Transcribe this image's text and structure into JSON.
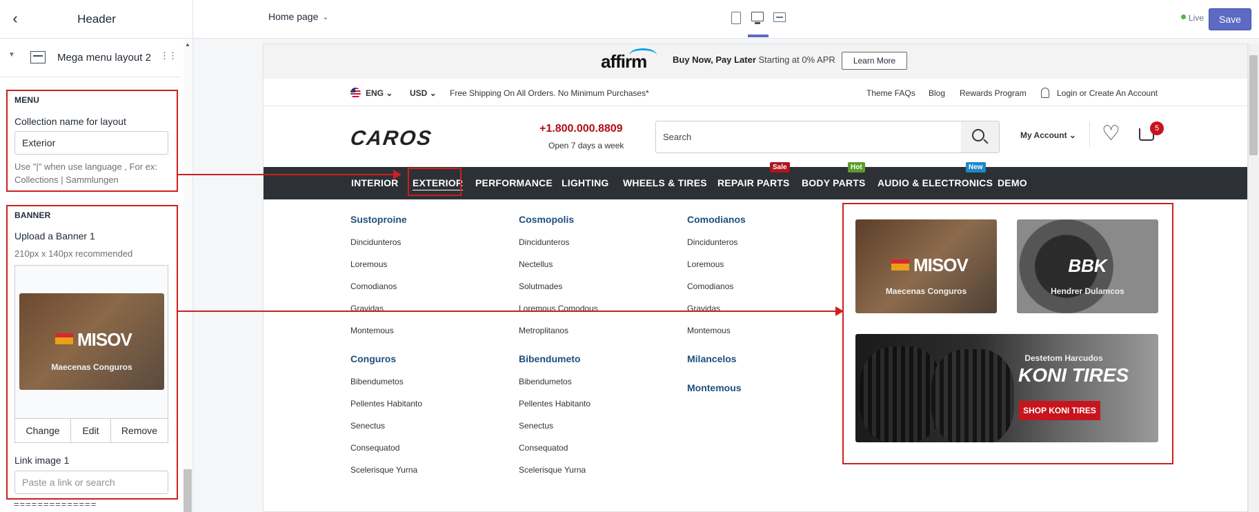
{
  "sidebar": {
    "title": "Header",
    "layout_name": "Mega menu layout 2",
    "menu": {
      "section_title": "MENU",
      "collection_label": "Collection name for layout",
      "collection_value": "Exterior",
      "help": "Use \"|\" when use language , For ex: Collections | Sammlungen"
    },
    "banner": {
      "section_title": "BANNER",
      "upload_label": "Upload a Banner 1",
      "upload_help": "210px x 140px recommended",
      "thumb_caption": "Maecenas Conguros",
      "thumb_brand": "MISOV",
      "change_label": "Change",
      "edit_label": "Edit",
      "remove_label": "Remove",
      "link_label": "Link image 1",
      "link_placeholder": "Paste a link or search"
    },
    "divider_text": "=============="
  },
  "topbar": {
    "page_select": "Home page",
    "live_label": "Live",
    "save_label": "Save",
    "accent": "#5c6ac4"
  },
  "store": {
    "promo": {
      "logo": "affirm",
      "headline": "Buy Now, Pay Later",
      "sub": " Starting at 0% APR",
      "button": "Learn More"
    },
    "utility": {
      "lang": "ENG",
      "currency": "USD",
      "shipping": "Free Shipping On All Orders. No Minimum Purchases*",
      "links": [
        "Theme FAQs",
        "Blog",
        "Rewards Program"
      ],
      "account": "Login or Create An Account"
    },
    "logo": "CAROS",
    "phone": "+1.800.000.8809",
    "phone_sub": "Open 7 days a week",
    "search_placeholder": "Search",
    "my_account": "My Account",
    "cart_count": "5",
    "nav": [
      {
        "label": "INTERIOR"
      },
      {
        "label": "EXTERIOR"
      },
      {
        "label": "PERFORMANCE"
      },
      {
        "label": "LIGHTING"
      },
      {
        "label": "WHEELS & TIRES"
      },
      {
        "label": "REPAIR PARTS",
        "badge": "Sale"
      },
      {
        "label": "BODY PARTS",
        "badge": "Hot"
      },
      {
        "label": "AUDIO & ELECTRONICS",
        "badge": "New"
      },
      {
        "label": "DEMO"
      }
    ],
    "badge_colors": {
      "Sale": "#b0141c",
      "Hot": "#5d9b2b",
      "New": "#1e88c8"
    },
    "mega": {
      "col1": {
        "h1": "Sustoproine",
        "l1": [
          "Dincidunteros",
          "Loremous",
          "Comodianos",
          "Gravidas",
          "Montemous"
        ],
        "h2": "Conguros",
        "l2": [
          "Bibendumetos",
          "Pellentes Habitanto",
          "Senectus",
          "Consequatod",
          "Scelerisque Yurna"
        ]
      },
      "col2": {
        "h1": "Cosmopolis",
        "l1": [
          "Dincidunteros",
          "Nectellus",
          "Solutmades",
          "Loremous Comodous",
          "Metroplitanos"
        ],
        "h2": "Bibendumeto",
        "l2": [
          "Bibendumetos",
          "Pellentes Habitanto",
          "Senectus",
          "Consequatod",
          "Scelerisque Yurna"
        ]
      },
      "col3": {
        "h1": "Comodianos",
        "l1": [
          "Dincidunteros",
          "Loremous",
          "Comodianos",
          "Gravidas",
          "Montemous"
        ],
        "h2": "Milancelos",
        "h3": "Montemous"
      }
    },
    "banners": {
      "b1_brand": "MISOV",
      "b1_caption": "Maecenas Conguros",
      "b2_brand": "BBK",
      "b2_caption": "Hendrer Dulamcos",
      "b3_top": "Destetom Harcudos",
      "b3_brand": "KONI TIRES",
      "b3_cta": "SHOP KONI TIRES"
    }
  }
}
